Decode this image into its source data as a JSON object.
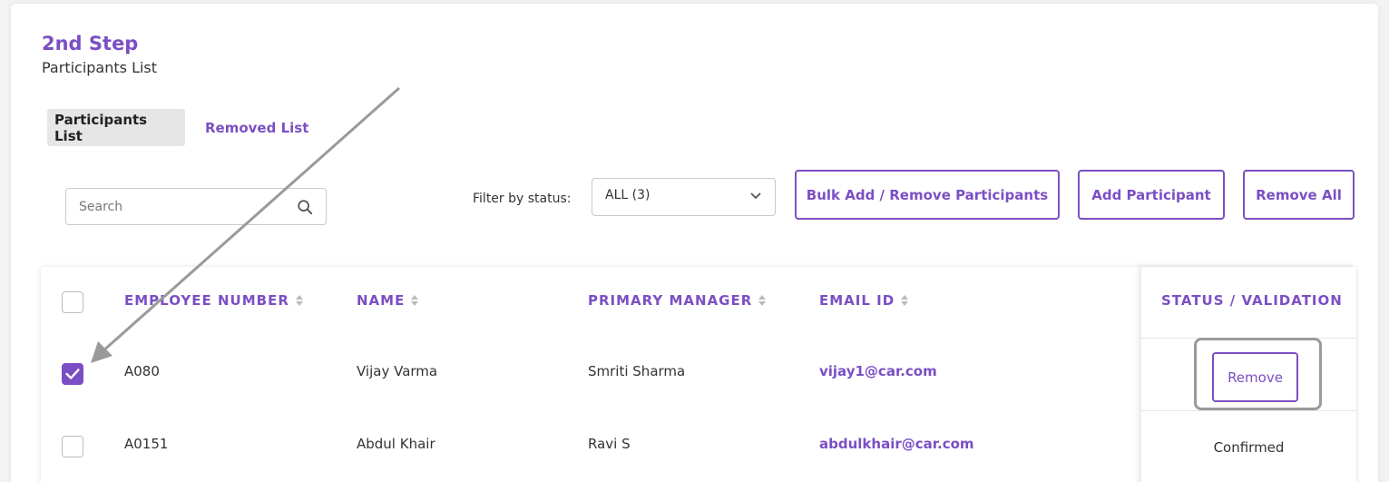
{
  "step": {
    "title": "2nd Step",
    "subtitle": "Participants List"
  },
  "tabs": [
    {
      "label": "Participants List",
      "active": true
    },
    {
      "label": "Removed List",
      "active": false
    }
  ],
  "search": {
    "placeholder": "Search"
  },
  "filter": {
    "label": "Filter by status:",
    "selected": "ALL (3)"
  },
  "actions": {
    "bulk": "Bulk Add / Remove Participants",
    "add": "Add Participant",
    "remove_all": "Remove All"
  },
  "table": {
    "headers": {
      "employee_number": "EMPLOYEE NUMBER",
      "name": "NAME",
      "primary_manager": "PRIMARY MANAGER",
      "email": "EMAIL ID",
      "status": "STATUS / VALIDATION"
    },
    "rows": [
      {
        "checked": true,
        "employee_number": "A080",
        "name": "Vijay Varma",
        "primary_manager": "Smriti Sharma",
        "email": "vijay1@car.com",
        "status_action": "Remove"
      },
      {
        "checked": false,
        "employee_number": "A0151",
        "name": "Abdul Khair",
        "primary_manager": "Ravi S",
        "email": "abdulkhair@car.com",
        "status": "Confirmed"
      }
    ]
  },
  "colors": {
    "accent": "#7b4fc4",
    "tab_active_bg": "#e6e6e6",
    "highlight": "#9a9a9a"
  }
}
